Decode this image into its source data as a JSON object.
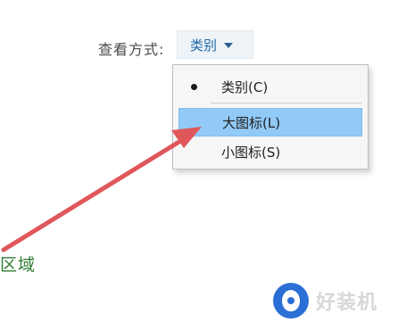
{
  "header": {
    "view_by_label": "查看方式:",
    "view_by_value": "类别"
  },
  "menu": {
    "items": [
      {
        "label": "类别(C)"
      },
      {
        "label": "大图标(L)"
      },
      {
        "label": "小图标(S)"
      }
    ]
  },
  "annotation": {
    "region_text": "区域"
  },
  "watermark": {
    "text": "好装机"
  },
  "colors": {
    "selected_item_bg": "#91c9f7",
    "arrow": "#e0575b",
    "dropdown_text": "#1e67a8",
    "region_text": "#2e7d32"
  },
  "icons": {
    "dropdown_caret": "chevron-down-icon",
    "selected_bullet": "radio-bullet-icon",
    "watermark_logo": "watermark-logo-icon"
  }
}
